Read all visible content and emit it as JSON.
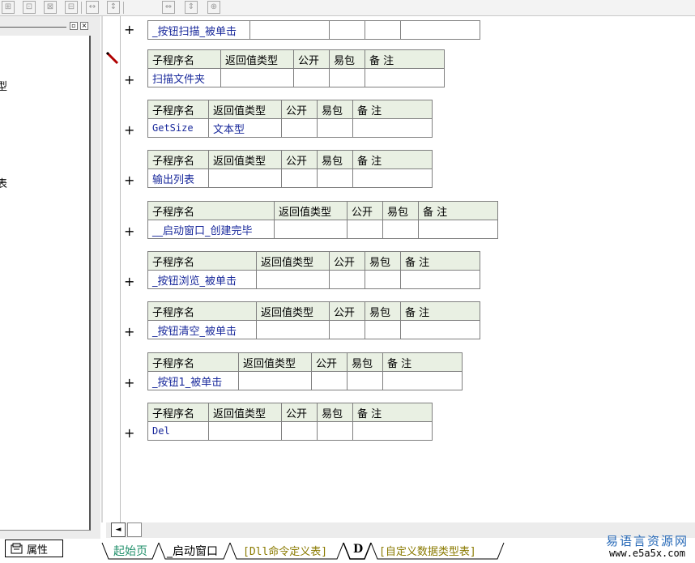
{
  "toolbar": {
    "icons": [
      "align-grid-icon",
      "align-center-icon",
      "align-top-icon",
      "align-split-icon",
      "space-horizontal-icon",
      "space-vertical-icon",
      "width-icon",
      "height-icon",
      "size-icon"
    ],
    "glyphs": [
      "⊞",
      "⊡",
      "⊠",
      "⊟",
      "↔",
      "↕",
      "⇔",
      "⇕",
      "⊕"
    ]
  },
  "left_panel": {
    "close_glyph": "×",
    "minimize_glyph": "▫",
    "fragments": [
      "型",
      "表"
    ],
    "properties_tab": "属性"
  },
  "subroutines": [
    {
      "name": "_按钮扫描_被单击",
      "header": false
    },
    {
      "header_labels": [
        "子程序名",
        "返回值类型",
        "公开",
        "易包",
        "备 注"
      ],
      "name": "扫描文件夹",
      "return_type": "",
      "header": true
    },
    {
      "header_labels": [
        "子程序名",
        "返回值类型",
        "公开",
        "易包",
        "备 注"
      ],
      "name": "GetSize",
      "return_type": "文本型",
      "header": true
    },
    {
      "header_labels": [
        "子程序名",
        "返回值类型",
        "公开",
        "易包",
        "备 注"
      ],
      "name": "输出列表",
      "return_type": "",
      "header": true
    },
    {
      "header_labels": [
        "子程序名",
        "返回值类型",
        "公开",
        "易包",
        "备 注"
      ],
      "name": "__启动窗口_创建完毕",
      "return_type": "",
      "header": true
    },
    {
      "header_labels": [
        "子程序名",
        "返回值类型",
        "公开",
        "易包",
        "备 注"
      ],
      "name": "_按钮浏览_被单击",
      "return_type": "",
      "header": true
    },
    {
      "header_labels": [
        "子程序名",
        "返回值类型",
        "公开",
        "易包",
        "备 注"
      ],
      "name": "_按钮清空_被单击",
      "return_type": "",
      "header": true
    },
    {
      "header_labels": [
        "子程序名",
        "返回值类型",
        "公开",
        "易包",
        "备 注"
      ],
      "name": "_按钮1_被单击",
      "return_type": "",
      "header": true
    },
    {
      "header_labels": [
        "子程序名",
        "返回值类型",
        "公开",
        "易包",
        "备 注"
      ],
      "name": "Del",
      "return_type": "",
      "header": true
    }
  ],
  "expand_glyph": "+",
  "tabs": [
    {
      "label": "起始页",
      "color": "#1f8f6a"
    },
    {
      "label": "_启动窗口",
      "color": "#000000"
    },
    {
      "label": "[Dll命令定义表]",
      "color": "#8a7a00"
    },
    {
      "label": "D",
      "color": "#000000"
    },
    {
      "label": "[自定义数据类型表]",
      "color": "#8a7a00"
    }
  ],
  "logo": {
    "name": "易语言资源网",
    "url": "www.e5a5x.com"
  },
  "scroll_left_glyph": "◄"
}
